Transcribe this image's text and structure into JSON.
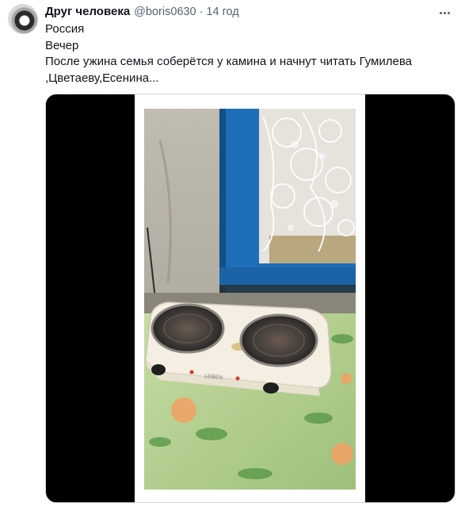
{
  "tweet": {
    "display_name": "Друг человека",
    "handle": "@boris0630",
    "separator": "·",
    "timestamp": "14 год",
    "text_lines": [
      "Россия",
      "Вечер",
      "После ужина семья соберётся у камина и начнут читать Гумилева",
      ",Цветаеву,Есенина..."
    ],
    "stove_brand": "LEBEN"
  },
  "icons": {
    "avatar": "profile-avatar",
    "more": "more-options-icon"
  },
  "colors": {
    "text_primary": "#0f1419",
    "text_secondary": "#536471",
    "media_background": "#000000",
    "window_frame_blue": "#1e6fb8"
  }
}
